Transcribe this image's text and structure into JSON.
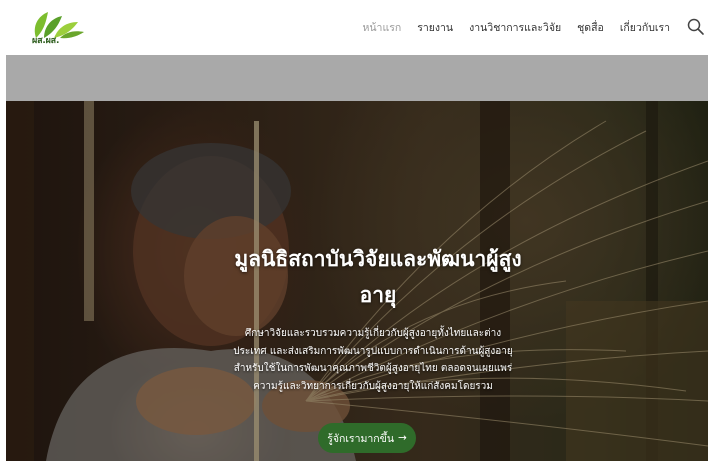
{
  "logo": {
    "text": "ผส.ผส."
  },
  "nav": {
    "items": [
      {
        "label": "หน้าแรก",
        "active": true
      },
      {
        "label": "รายงาน",
        "active": false
      },
      {
        "label": "งานวิชาการและวิจัย",
        "active": false
      },
      {
        "label": "ชุดสื่อ",
        "active": false
      },
      {
        "label": "เกี่ยวกับเรา",
        "active": false
      }
    ],
    "search_icon": "search-icon"
  },
  "hero": {
    "title_line1": "มูลนิธิสถาบันวิจัยและพัฒนาผู้สูง",
    "title_line2": "อายุ",
    "description_lines": [
      "ศึกษาวิจัยและรวบรวมความรู้เกี่ยวกับผู้สูงอายุทั้งไทยและต่าง",
      "ประเทศ และส่งเสริมการพัฒนารูปแบบการดำเนินการด้านผู้สูงอายุ",
      "สำหรับใช้ในการพัฒนาคุณภาพชีวิตผู้สูงอายุไทย ตลอดจนเผยแพร่",
      "ความรู้และวิทยาการเกี่ยวกับผู้สูงอายุให้แก่สังคมโดยรวม"
    ],
    "button_label": "รู้จักเรามากขึ้น",
    "button_icon": "arrow-right-icon"
  },
  "colors": {
    "brand_green": "#2f6b2a",
    "band_grey": "#a9a9a9",
    "nav_active": "#9a9a9a",
    "nav_text": "#333333"
  }
}
